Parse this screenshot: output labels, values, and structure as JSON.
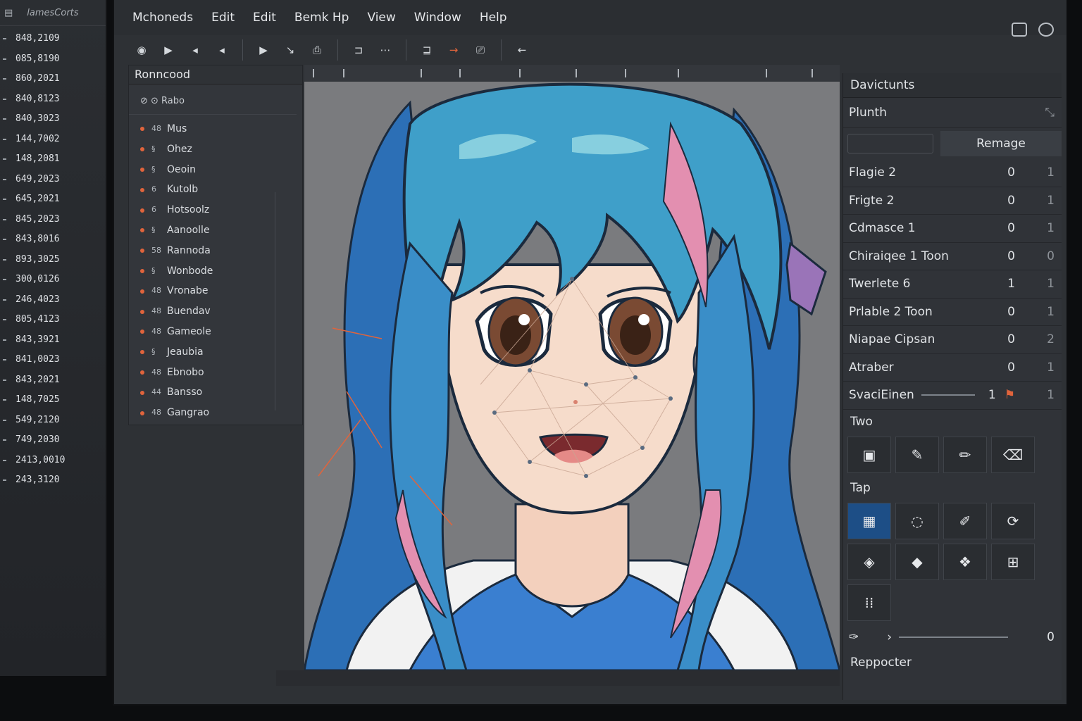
{
  "left_panel": {
    "header": "lamesCorts",
    "values": [
      "848,2109",
      "085,8190",
      "860,2021",
      "840,8123",
      "840,3023",
      "144,7002",
      "148,2081",
      "649,2023",
      "645,2021",
      "845,2023",
      "843,8016",
      "893,3025",
      "300,0126",
      "246,4023",
      "805,4123",
      "843,3921",
      "841,0023",
      "843,2021",
      "148,7025",
      "549,2120",
      "749,2030",
      "2413,0010",
      "243,3120"
    ]
  },
  "menubar": {
    "items": [
      "Mchoneds",
      "Edit",
      "Edit",
      "Bemk Hp",
      "View",
      "Window",
      "Help"
    ]
  },
  "toolbar": {
    "icons": [
      "record-icon",
      "play-icon",
      "prev-icon",
      "back-icon",
      "forward-icon",
      "pen-icon",
      "camera-icon",
      "frame-icon",
      "keyframe-icon",
      "arrow-right-icon",
      "print-icon",
      "arrow-left-icon"
    ]
  },
  "layers": {
    "title": "Ronncood",
    "subheader": "⊘ ⊙ Rabo",
    "items": [
      {
        "icon": "48",
        "name": "Mus"
      },
      {
        "icon": "§",
        "name": "Ohez"
      },
      {
        "icon": "§",
        "name": "Oeoin"
      },
      {
        "icon": "6",
        "name": "Kutolb"
      },
      {
        "icon": "6",
        "name": "Hotsoolz"
      },
      {
        "icon": "§",
        "name": "Aanoolle"
      },
      {
        "icon": "58",
        "name": "Rannoda"
      },
      {
        "icon": "§",
        "name": "Wonbode"
      },
      {
        "icon": "48",
        "name": "Vronabe"
      },
      {
        "icon": "48",
        "name": "Buendav"
      },
      {
        "icon": "48",
        "name": "Gameole"
      },
      {
        "icon": "§",
        "name": "Jeaubia"
      },
      {
        "icon": "48",
        "name": "Ebnobo"
      },
      {
        "icon": "44",
        "name": "Bansso"
      },
      {
        "icon": "48",
        "name": "Gangrao"
      }
    ]
  },
  "props": {
    "title": "Davictunts",
    "plunch_label": "Plunth",
    "remage_button": "Remage",
    "rows": [
      {
        "label": "Flagie 2",
        "v": "0",
        "v2": "1"
      },
      {
        "label": "Frigte 2",
        "v": "0",
        "v2": "1"
      },
      {
        "label": "Cdmasce 1",
        "v": "0",
        "v2": "1"
      },
      {
        "label": "Chiraiqee 1 Toon",
        "v": "0",
        "v2": "0"
      },
      {
        "label": "Twerlete 6",
        "v": "1",
        "v2": "1"
      },
      {
        "label": "Prlable 2 Toon",
        "v": "0",
        "v2": "1"
      },
      {
        "label": "Niapae Cipsan",
        "v": "0",
        "v2": "2"
      },
      {
        "label": "Atraber",
        "v": "0",
        "v2": "1"
      }
    ],
    "slider_row": {
      "label": "SvaciEinen",
      "v": "1",
      "v2": "1"
    },
    "two_label": "Two",
    "tap_label": "Tap",
    "repporter_label": "Reppocter",
    "bottom_value": "0"
  },
  "colors": {
    "hair": "#3f9fc9",
    "hair_dark": "#2c6fb6",
    "pink": "#e38fb0",
    "skin": "#f6dccb",
    "bow": "#9a74b8",
    "accent": "#e0643c"
  }
}
